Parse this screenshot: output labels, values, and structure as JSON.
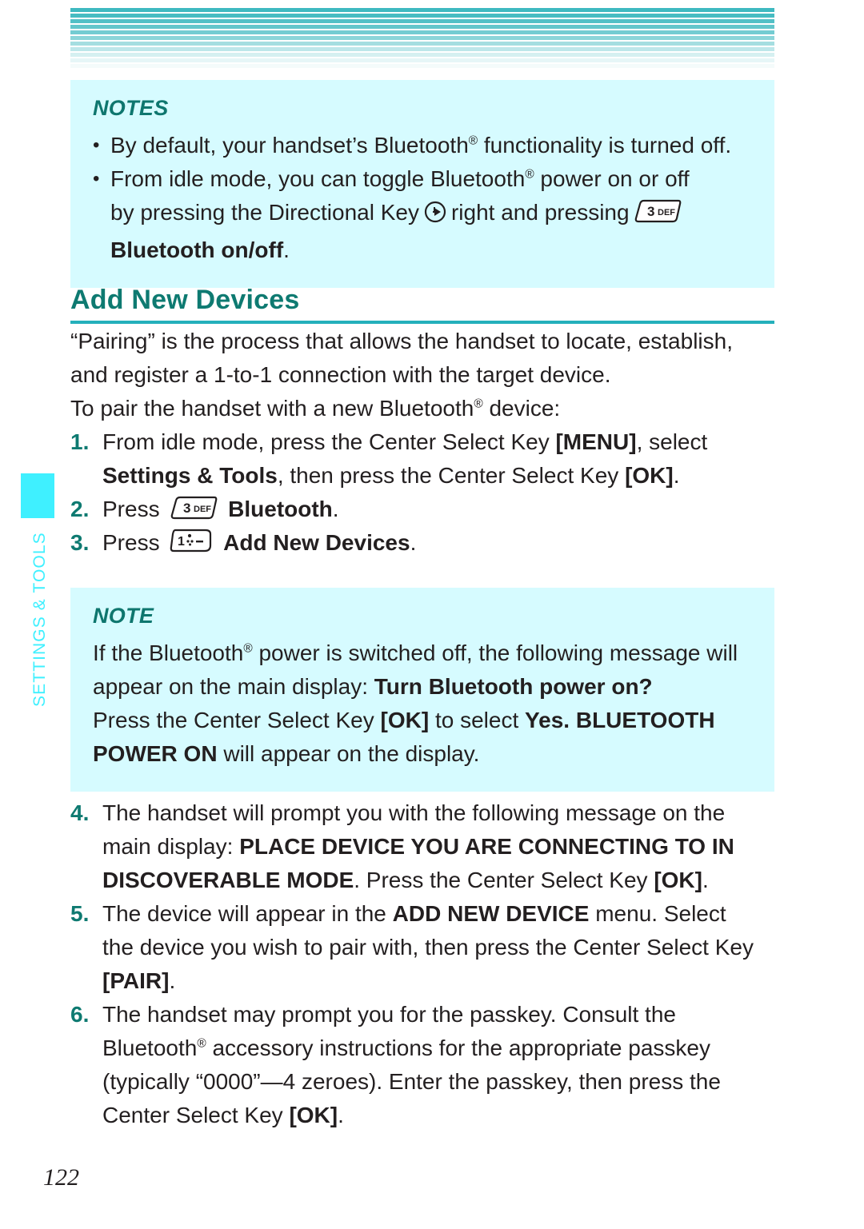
{
  "colors": {
    "teal": "#0e7a71",
    "rule_teal": "#24b0bb",
    "note_bg": "#d6fbff",
    "tab_cyan": "#3ff0ff",
    "stripe": "#3fb9c0"
  },
  "sidebar": {
    "tab_label": "SETTINGS & TOOLS"
  },
  "notes_box": {
    "title": "NOTES",
    "bullets": [
      {
        "dot": "•",
        "lines": [
          "By default, your handset’s Bluetooth® functionality is turned off."
        ]
      },
      {
        "dot": "•",
        "lines": [
          "From idle mode, you can toggle Bluetooth® power on or off",
          "by pressing the Directional Key ⊕ right and pressing [3 DEF]",
          "Bluetooth on/off."
        ]
      }
    ],
    "line2_pre": "by pressing the Directional Key",
    "line2_mid": "right and pressing",
    "line3_bold": "Bluetooth on/off",
    "line3_tail": "."
  },
  "section": {
    "heading": "Add New Devices",
    "intro": [
      "“Pairing” is the process that allows the handset to locate, establish,",
      "and register a 1-to-1 connection with the target device.",
      "To pair the handset with a new Bluetooth® device:"
    ]
  },
  "steps_first": [
    {
      "num": "1.",
      "lines": [
        {
          "parts": [
            {
              "t": "From idle mode, press the Center Select Key ",
              "b": false
            },
            {
              "t": "[MENU]",
              "b": true
            },
            {
              "t": ", select",
              "b": false
            }
          ]
        },
        {
          "parts": [
            {
              "t": "Settings & Tools",
              "b": true
            },
            {
              "t": ", then press the Center Select Key ",
              "b": false
            },
            {
              "t": "[OK]",
              "b": true
            },
            {
              "t": ".",
              "b": false
            }
          ]
        }
      ]
    },
    {
      "num": "2.",
      "key": "3 DEF",
      "lines": [
        {
          "parts": [
            {
              "t": "Press ",
              "b": false
            },
            {
              "t": "KEY3",
              "b": false,
              "icon": true
            },
            {
              "t": "Bluetooth",
              "b": true
            },
            {
              "t": ".",
              "b": false
            }
          ]
        }
      ]
    },
    {
      "num": "3.",
      "key": "1",
      "lines": [
        {
          "parts": [
            {
              "t": "Press ",
              "b": false
            },
            {
              "t": "KEY1",
              "b": false,
              "icon": true
            },
            {
              "t": "Add New Devices",
              "b": true
            },
            {
              "t": ".",
              "b": false
            }
          ]
        }
      ]
    }
  ],
  "note_box": {
    "title": "NOTE",
    "lines": [
      [
        {
          "t": "If the Bluetooth",
          "b": false
        },
        {
          "t": "®",
          "b": false,
          "sup": true
        },
        {
          "t": " power is switched off, the following message will",
          "b": false
        }
      ],
      [
        {
          "t": "appear on the main display: ",
          "b": false
        },
        {
          "t": "Turn Bluetooth power on?",
          "b": true
        }
      ],
      [
        {
          "t": "Press the Center Select Key ",
          "b": false
        },
        {
          "t": "[OK]",
          "b": true
        },
        {
          "t": " to select ",
          "b": false
        },
        {
          "t": "Yes. BLUETOOTH",
          "b": true
        }
      ],
      [
        {
          "t": "POWER ON",
          "b": true
        },
        {
          "t": " will appear on the display.",
          "b": false
        }
      ]
    ]
  },
  "steps_second": [
    {
      "num": "4.",
      "lines": [
        [
          {
            "t": "The handset will prompt you with the following message on the",
            "b": false
          }
        ],
        [
          {
            "t": "main display: ",
            "b": false
          },
          {
            "t": "PLACE DEVICE YOU ARE CONNECTING TO IN",
            "b": true
          }
        ],
        [
          {
            "t": "DISCOVERABLE MODE",
            "b": true
          },
          {
            "t": ". Press the Center Select Key ",
            "b": false
          },
          {
            "t": "[OK]",
            "b": true
          },
          {
            "t": ".",
            "b": false
          }
        ]
      ]
    },
    {
      "num": "5.",
      "lines": [
        [
          {
            "t": "The device will appear in the ",
            "b": false
          },
          {
            "t": "ADD NEW DEVICE",
            "b": true
          },
          {
            "t": " menu. Select",
            "b": false
          }
        ],
        [
          {
            "t": "the device you wish to pair with, then press the Center Select Key",
            "b": false
          }
        ],
        [
          {
            "t": "[PAIR]",
            "b": true
          },
          {
            "t": ".",
            "b": false
          }
        ]
      ]
    },
    {
      "num": "6.",
      "lines": [
        [
          {
            "t": "The handset may prompt you for the passkey. Consult the",
            "b": false
          }
        ],
        [
          {
            "t": "Bluetooth",
            "b": false
          },
          {
            "t": "®",
            "b": false,
            "sup": true
          },
          {
            "t": " accessory instructions for the appropriate passkey",
            "b": false
          }
        ],
        [
          {
            "t": "(typically “0000”—4 zeroes). Enter the passkey, then press the",
            "b": false
          }
        ],
        [
          {
            "t": "Center Select Key ",
            "b": false
          },
          {
            "t": "[OK]",
            "b": true
          },
          {
            "t": ".",
            "b": false
          }
        ]
      ]
    }
  ],
  "keys": {
    "key3_digit": "3",
    "key3_letters": "DEF",
    "key1_digit": "1"
  },
  "footer": {
    "page_number": "122"
  }
}
